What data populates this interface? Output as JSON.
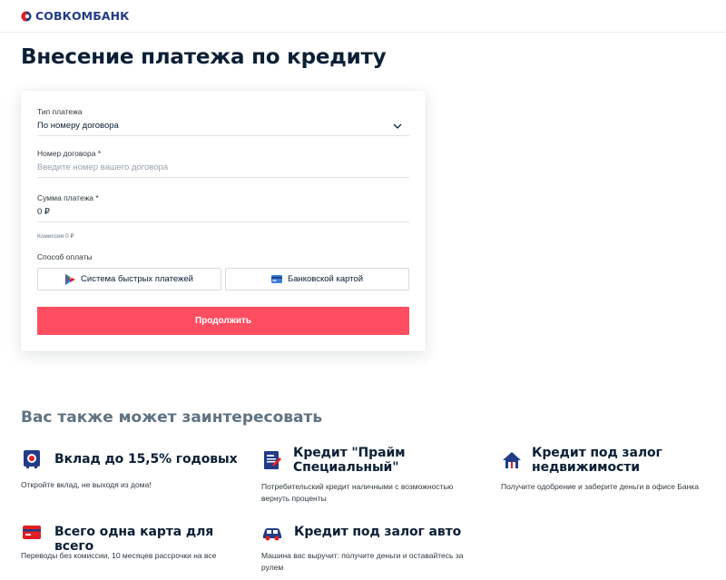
{
  "brand": {
    "name": "СОВКОМБАНК",
    "colors": {
      "primary": "#223c87",
      "accent": "#e31e24",
      "button": "#ff4d61"
    }
  },
  "page": {
    "title": "Внесение платежа по кредиту"
  },
  "form": {
    "payment_type": {
      "label": "Тип платежа",
      "value": "По номеру договора",
      "icon": "chevron-down-icon"
    },
    "contract_number": {
      "label": "Номер договора *",
      "placeholder": "Введите номер вашего договора"
    },
    "amount": {
      "label": "Сумма платежа *",
      "value": "0 ₽"
    },
    "commission": "Комиссия 0 ₽",
    "method_label": "Способ оплаты",
    "methods": [
      {
        "label": "Система быстрых платежей",
        "icon": "sbp-icon"
      },
      {
        "label": "Банковской картой",
        "icon": "bank-card-icon"
      }
    ],
    "submit_label": "Продолжить"
  },
  "offers": {
    "title": "Вас также может заинтересовать",
    "items": [
      {
        "title": "Вклад до 15,5% годовых",
        "description": "Откройте вклад, не выходя из дома!",
        "icon": "safe-icon"
      },
      {
        "title": "Кредит \"Прайм Специальный\"",
        "description": "Потребительский кредит наличными с возможностью вернуть проценты",
        "icon": "document-icon"
      },
      {
        "title": "Кредит под залог недвижимости",
        "description": "Получите одобрение и заберите деньги в офисе Банка",
        "icon": "house-icon"
      },
      {
        "title": "Всего одна карта для всего",
        "description": "Переводы без комиссии, 10 месяцев рассрочки на все",
        "icon": "card-icon"
      },
      {
        "title": "Кредит под залог авто",
        "description": "Машина вас выручит: получите деньги и оставайтесь за рулем",
        "icon": "car-icon"
      }
    ]
  }
}
